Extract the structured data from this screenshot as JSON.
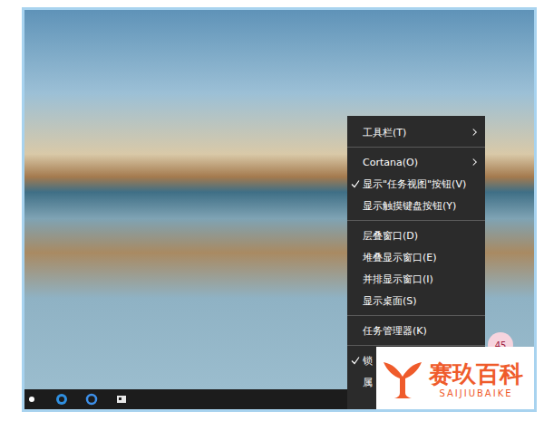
{
  "desktop": {
    "wallpaper": "photo"
  },
  "context_menu": {
    "items": [
      {
        "kind": "item",
        "label": "工具栏(T)",
        "checked": false,
        "submenu": true
      },
      {
        "kind": "separator"
      },
      {
        "kind": "item",
        "label": "Cortana(O)",
        "checked": false,
        "submenu": true
      },
      {
        "kind": "item",
        "label": "显示\"任务视图\"按钮(V)",
        "checked": true,
        "submenu": false
      },
      {
        "kind": "item",
        "label": "显示触摸键盘按钮(Y)",
        "checked": false,
        "submenu": false
      },
      {
        "kind": "separator"
      },
      {
        "kind": "item",
        "label": "层叠窗口(D)",
        "checked": false,
        "submenu": false
      },
      {
        "kind": "item",
        "label": "堆叠显示窗口(E)",
        "checked": false,
        "submenu": false
      },
      {
        "kind": "item",
        "label": "并排显示窗口(I)",
        "checked": false,
        "submenu": false
      },
      {
        "kind": "item",
        "label": "显示桌面(S)",
        "checked": false,
        "submenu": false
      },
      {
        "kind": "separator"
      },
      {
        "kind": "item",
        "label": "任务管理器(K)",
        "checked": false,
        "submenu": false
      },
      {
        "kind": "separator"
      },
      {
        "kind": "item",
        "label": "锁",
        "checked": true,
        "submenu": false
      },
      {
        "kind": "item",
        "label": "属",
        "checked": false,
        "submenu": false
      }
    ]
  },
  "badge": "45",
  "watermark": {
    "title": "赛玖百科",
    "subtitle": "SAIJIUBAIKE"
  }
}
